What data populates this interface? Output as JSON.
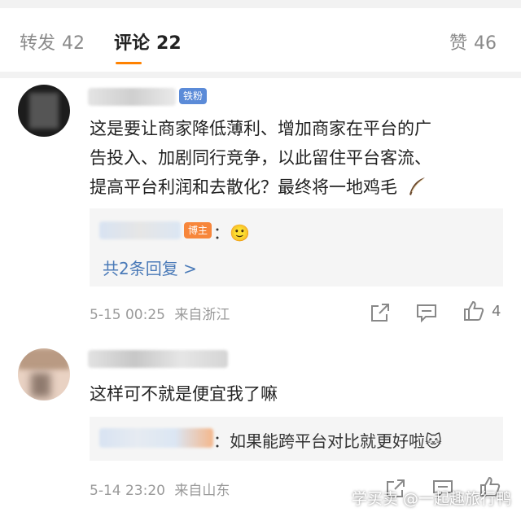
{
  "tabs": {
    "repost": {
      "label": "转发",
      "count": "42"
    },
    "comments": {
      "label": "评论",
      "count": "22"
    },
    "likes": {
      "label": "赞",
      "count": "46"
    }
  },
  "comments": [
    {
      "badge": "铁粉",
      "text_lines": [
        "这是要让商家降低薄利、增加商家在平台的广",
        "告投入、加剧同行竞争，以此留住平台客流、",
        "提高平台利润和去散化？最终将一地鸡毛"
      ],
      "reply": {
        "author_badge": "博主",
        "separator": "：",
        "emoji": "🙂"
      },
      "more_replies": "共2条回复 >",
      "timestamp": "5-15 00:25",
      "location": "来自浙江",
      "like_count": "4"
    },
    {
      "text_lines": [
        "这样可不就是便宜我了嘛"
      ],
      "reply": {
        "separator": "：",
        "text": "如果能跨平台对比就更好啦",
        "emoji": "🐱"
      },
      "timestamp": "5-14 23:20",
      "location": "来自山东"
    }
  ],
  "watermark": "学买卖 @一起趣旅行鸭",
  "colors": {
    "accent": "#ff8200",
    "link": "#4a7ab8",
    "fan_badge": "#5b8bd8",
    "host_badge": "#f7863b"
  }
}
